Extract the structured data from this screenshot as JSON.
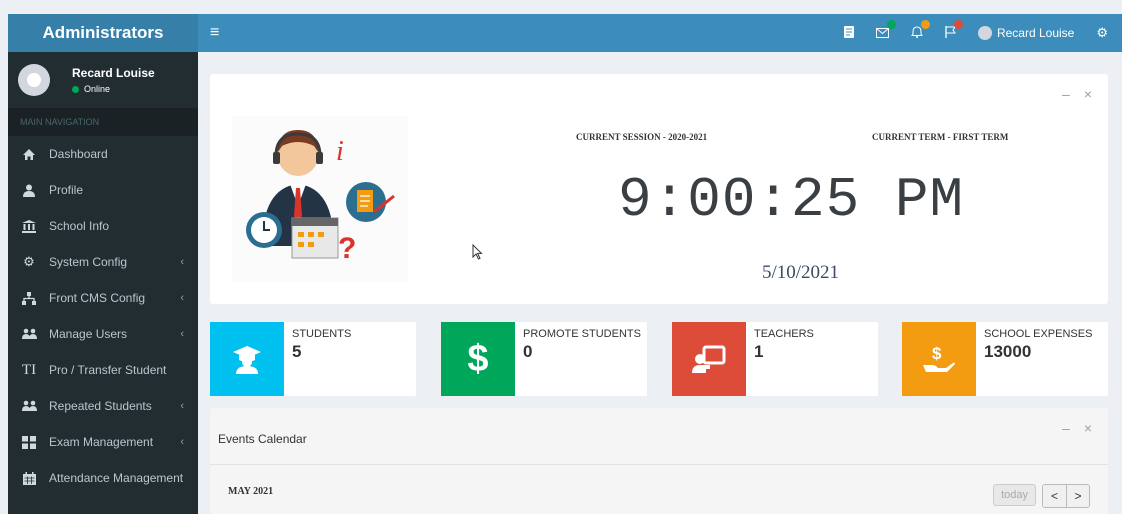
{
  "sidebar": {
    "brand": "Administrators",
    "user": {
      "name": "Recard Louise",
      "status": "Online"
    },
    "nav_header": "MAIN NAVIGATION",
    "items": [
      {
        "label": "Dashboard",
        "icon": "home-icon",
        "has_submenu": false
      },
      {
        "label": "Profile",
        "icon": "user-icon",
        "has_submenu": false
      },
      {
        "label": "School Info",
        "icon": "bank-icon",
        "has_submenu": false
      },
      {
        "label": "System Config",
        "icon": "cogs-icon",
        "has_submenu": true
      },
      {
        "label": "Front CMS Config",
        "icon": "sitemap-icon",
        "has_submenu": true
      },
      {
        "label": "Manage Users",
        "icon": "users-icon",
        "has_submenu": true
      },
      {
        "label": "Pro / Transfer Student",
        "icon": "text-height-icon",
        "has_submenu": false
      },
      {
        "label": "Repeated Students",
        "icon": "users-icon",
        "has_submenu": true
      },
      {
        "label": "Exam Management",
        "icon": "th-large-icon",
        "has_submenu": true
      },
      {
        "label": "Attendance Management",
        "icon": "calendar-icon",
        "has_submenu": false
      }
    ]
  },
  "topbar": {
    "menu_icon": "hamburger-icon",
    "user_name": "Recard Louise"
  },
  "hero": {
    "session": "CURRENT SESSION - 2020-2021",
    "term": "CURRENT TERM - FIRST TERM",
    "time": "9:00:25 PM",
    "date": "5/10/2021"
  },
  "stats": [
    {
      "label": "STUDENTS",
      "value": "5",
      "color": "#00c0ef",
      "icon": "graduate-icon"
    },
    {
      "label": "PROMOTE STUDENTS",
      "value": "0",
      "color": "#00a65a",
      "icon": "dollar-icon"
    },
    {
      "label": "TEACHERS",
      "value": "1",
      "color": "#dd4b39",
      "icon": "chalkboard-teacher-icon"
    },
    {
      "label": "SCHOOL EXPENSES",
      "value": "13000",
      "color": "#f39c12",
      "icon": "hand-holding-dollar-icon"
    }
  ],
  "calendar": {
    "title": "Events Calendar",
    "month": "MAY 2021",
    "today_label": "today",
    "prev_label": "<",
    "next_label": ">"
  }
}
